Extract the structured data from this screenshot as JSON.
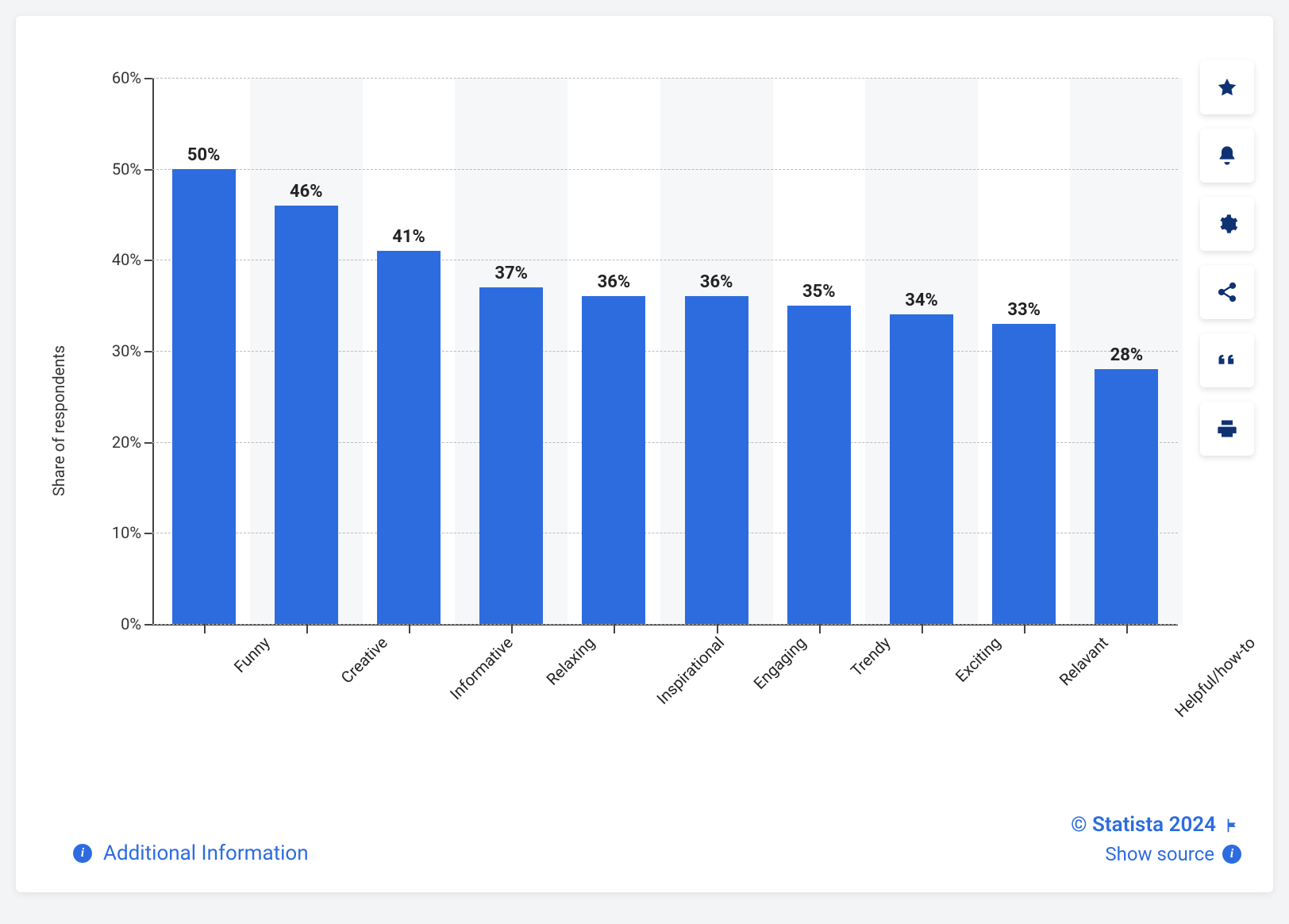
{
  "chart_data": {
    "type": "bar",
    "categories": [
      "Funny",
      "Creative",
      "Informative",
      "Relaxing",
      "Inspirational",
      "Engaging",
      "Trendy",
      "Exciting",
      "Relavant",
      "Helpful/how-to"
    ],
    "values": [
      50,
      46,
      41,
      37,
      36,
      36,
      35,
      34,
      33,
      28
    ],
    "value_suffix": "%",
    "ylabel": "Share of respondents",
    "y_ticks": [
      0,
      10,
      20,
      30,
      40,
      50,
      60
    ],
    "ylim": [
      0,
      60
    ],
    "bar_color": "#2d6cdf"
  },
  "footer": {
    "additional_info": "Additional Information",
    "copyright": "© Statista 2024",
    "show_source": "Show source"
  },
  "toolbar": {
    "favorite": "favorite",
    "notify": "notify",
    "settings": "settings",
    "share": "share",
    "cite": "cite",
    "print": "print"
  }
}
